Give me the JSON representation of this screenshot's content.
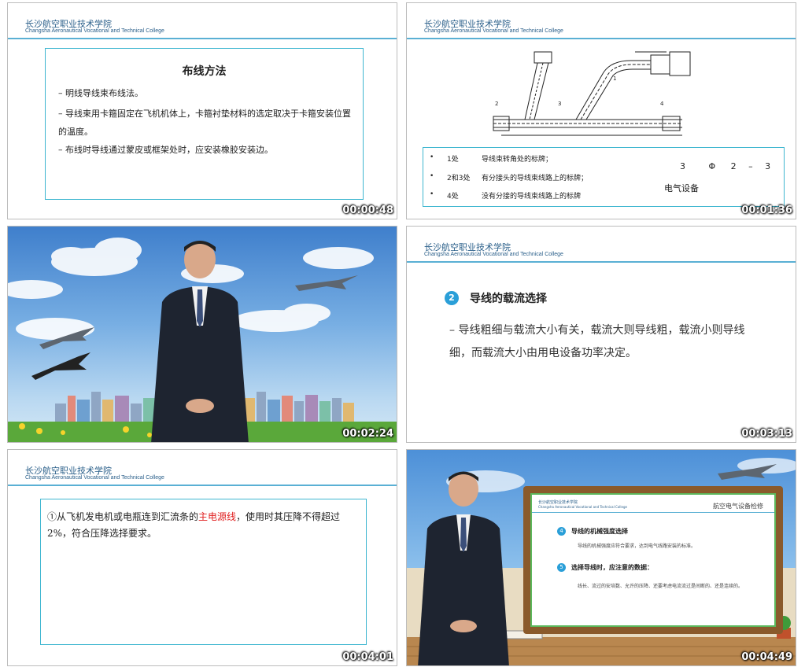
{
  "college": {
    "cn": "长沙航空职业技术学院",
    "en": "Changsha Aeronautical Vocational and Technical College"
  },
  "thumbs": [
    {
      "time": "00:00:48",
      "title": "布线方法",
      "items": [
        "–  明线导线束布线法。",
        "–  导线束用卡箍固定在飞机机体上，卡箍衬垫材料的选定取决于卡箍安装位置的温度。",
        "–  布线时导线通过蒙皮或框架处时，应安装橡胶安装边。"
      ]
    },
    {
      "time": "00:01:36",
      "rows": [
        {
          "num": "1处",
          "desc": "导线束转角处的标牌；"
        },
        {
          "num": "2和3处",
          "desc": "有分接头的导线束线路上的标牌；"
        },
        {
          "num": "4处",
          "desc": "没有分接的导线束线路上的标牌"
        }
      ],
      "code": [
        "3",
        "Φ",
        "2",
        "–",
        "3"
      ],
      "device": "电气设备",
      "callouts": [
        "1",
        "2",
        "3",
        "4"
      ]
    },
    {
      "time": "00:02:24"
    },
    {
      "time": "00:03:13",
      "num": "2",
      "heading": "导线的载流选择",
      "body": "–  导线粗细与载流大小有关，载流大则导线粗，载流小则导线细，而载流大小由用电设备功率决定。"
    },
    {
      "time": "00:04:01",
      "pre": "①从飞机发电机或电瓶连到汇流条的",
      "highlight": "主电源线",
      "post": "，使用时其压降不得超过2%，符合压降选择要求。"
    },
    {
      "time": "00:04:49",
      "board_title": "航空电气设备检修",
      "n4": "4",
      "h4": "导线的机械强度选择",
      "t4": "导线的机械强度应符合要求，达到电气线路安装的标准。",
      "n5": "5",
      "h5": "选择导线时，应注意的数据：",
      "t5": "线长、流过的安培数、允许的压降、还要考虑电流流过是间断的、还是连续的。"
    }
  ],
  "colors": {
    "accent": "#3eb6d0",
    "header_text": "#2a5f8a",
    "highlight": "#e02020",
    "badge": "#2a9fd8"
  }
}
